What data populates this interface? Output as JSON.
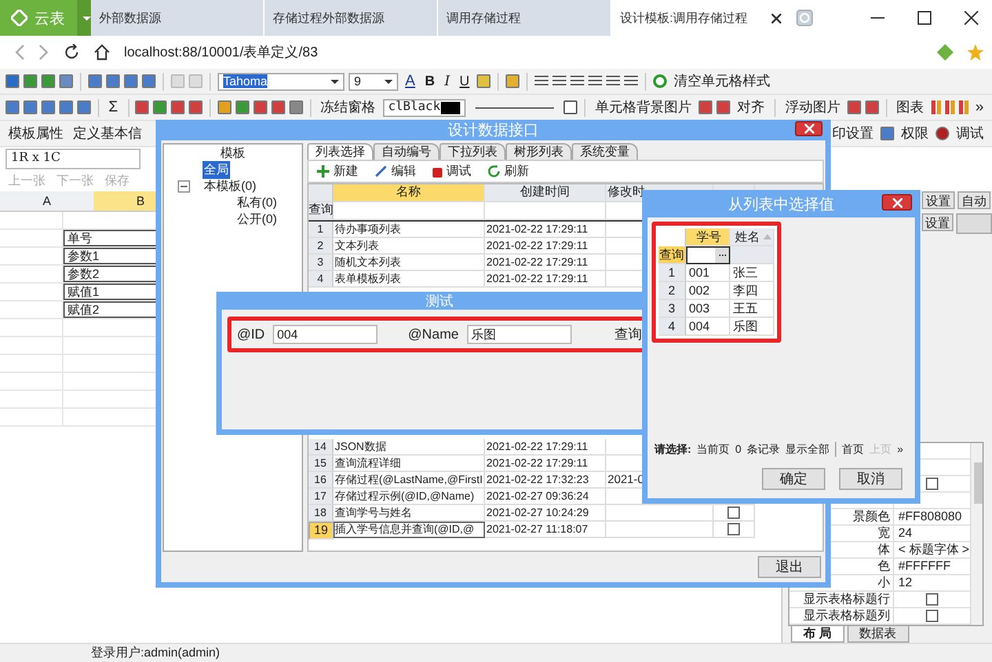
{
  "browser": {
    "brand": "云表",
    "tabs": [
      {
        "label": "外部数据源",
        "selected": false
      },
      {
        "label": "存储过程外部数据源",
        "selected": false
      },
      {
        "label": "调用存储过程",
        "selected": false
      },
      {
        "label": "设计模板:调用存储过程",
        "selected": true
      }
    ],
    "url": "localhost:88/10001/表单定义/83"
  },
  "toolbar": {
    "font": "Tahoma",
    "size": "9",
    "font_color": "A",
    "sum": "Σ",
    "bold": "B",
    "italic": "I",
    "underline": "U",
    "clear_style": "清空单元格样式",
    "freeze": "冻结窗格",
    "color_name": "clBlack",
    "cell_bg": "单元格背景图片",
    "align": "对齐",
    "float_image": "浮动图片",
    "chart": "图表",
    "more": "»",
    "template_props": "模板属性",
    "define_basic": "定义基本信",
    "print_settings": "印设置",
    "permissions": "权限",
    "debug": "调试"
  },
  "cell_ref": "1R x 1C",
  "nav": [
    {
      "label": "上一张",
      "disabled": true
    },
    {
      "label": "下一张",
      "disabled": true
    },
    {
      "label": "保存",
      "disabled": true
    }
  ],
  "sheet": {
    "columns": [
      {
        "label": "A",
        "selected": false
      },
      {
        "label": "B",
        "selected": true
      }
    ],
    "cells": [
      "单号",
      "参数1",
      "参数2",
      "赋值1",
      "赋值2"
    ]
  },
  "right_panel": {
    "buttons": [
      "设置",
      "自动",
      "设置"
    ],
    "properties": [
      {
        "kind": "blank"
      },
      {
        "kind": "blank"
      },
      {
        "kind": "check",
        "checked": false
      },
      {
        "kind": "blank"
      },
      {
        "kind": "text",
        "label": "景颜色",
        "value": "#FF808080"
      },
      {
        "kind": "text",
        "label": "宽",
        "value": "24"
      },
      {
        "kind": "text",
        "label": "体",
        "value": "< 标题字体 >"
      },
      {
        "kind": "text",
        "label": "色",
        "value": "#FFFFFF"
      },
      {
        "kind": "text",
        "label": "小",
        "value": "12"
      },
      {
        "kind": "check",
        "label": "显示表格标题行",
        "checked": false
      },
      {
        "kind": "check",
        "label": "显示表格标题列",
        "checked": false
      }
    ],
    "tabs": [
      {
        "label": "布 局",
        "selected": true
      },
      {
        "label": "数据表",
        "selected": false
      }
    ]
  },
  "status_bar": "登录用户:admin(admin)",
  "design_dialog": {
    "title": "设计数据接口",
    "tree_header": "模板",
    "tree": [
      {
        "label": "全局",
        "selected": true
      },
      {
        "label": "本模板(0)",
        "selected": false,
        "expanded": true,
        "children": [
          {
            "label": "私有(0)",
            "selected": false
          },
          {
            "label": "公开(0)",
            "selected": false
          }
        ]
      }
    ],
    "tabs": [
      {
        "label": "列表选择",
        "selected": true
      },
      {
        "label": "自动编号",
        "selected": false
      },
      {
        "label": "下拉列表",
        "selected": false
      },
      {
        "label": "树形列表",
        "selected": false
      },
      {
        "label": "系统变量",
        "selected": false
      }
    ],
    "actions": [
      {
        "label": "新建",
        "kind": "add"
      },
      {
        "label": "编辑",
        "kind": "edit"
      },
      {
        "label": "调试",
        "kind": "debug"
      },
      {
        "label": "刷新",
        "kind": "refresh"
      }
    ],
    "table": {
      "columns": [
        "名称",
        "创建时间",
        "修改时"
      ],
      "query_label": "查询",
      "rows_top": [
        {
          "num": "1",
          "name": "待办事项列表",
          "created": "2021-02-22 17:29:11",
          "selected": false
        },
        {
          "num": "2",
          "name": "文本列表",
          "created": "2021-02-22 17:29:11",
          "selected": false
        },
        {
          "num": "3",
          "name": "随机文本列表",
          "created": "2021-02-22 17:29:11",
          "selected": false
        },
        {
          "num": "4",
          "name": "表单模板列表",
          "created": "2021-02-22 17:29:11",
          "selected": false
        }
      ],
      "rows_bottom": [
        {
          "num": "14",
          "name": "JSON数据",
          "created": "2021-02-22 17:29:11",
          "selected": false
        },
        {
          "num": "15",
          "name": "查询流程详细",
          "created": "2021-02-22 17:29:11",
          "selected": false
        },
        {
          "num": "16",
          "name": "存储过程(@LastName,@FirstI",
          "created": "2021-02-22 17:32:23",
          "modified": "2021-0",
          "selected": false
        },
        {
          "num": "17",
          "name": "存储过程示例(@ID,@Name)",
          "created": "2021-02-27 09:36:24",
          "selected": false
        },
        {
          "num": "18",
          "name": "查询学号与姓名",
          "created": "2021-02-27 10:24:29",
          "checked": false,
          "selected": false
        },
        {
          "num": "19",
          "name": "插入学号信息并查询(@ID,@",
          "created": "2021-02-27 11:18:07",
          "checked": false,
          "selected": true
        }
      ]
    },
    "exit_button": "退出"
  },
  "test_dialog": {
    "title": "测试",
    "params": [
      {
        "label": "@ID",
        "value": "004"
      },
      {
        "label": "@Name",
        "value": "乐图"
      }
    ],
    "query_button": "查询"
  },
  "select_dialog": {
    "title": "从列表中选择值",
    "columns": [
      {
        "label": "学号",
        "selected": true,
        "sorted": false
      },
      {
        "label": "姓名",
        "selected": false,
        "sorted": true
      }
    ],
    "query_label": "查询",
    "rows": [
      {
        "num": "1",
        "id": "001",
        "name": "张三"
      },
      {
        "num": "2",
        "id": "002",
        "name": "李四"
      },
      {
        "num": "3",
        "id": "003",
        "name": "王五"
      },
      {
        "num": "4",
        "id": "004",
        "name": "乐图"
      }
    ],
    "pager": {
      "prompt": "请选择:",
      "current": "当前页",
      "count": "0",
      "records": "条记录",
      "show_all": "显示全部",
      "first": "首页",
      "prev": "上页",
      "more": "»"
    },
    "buttons": [
      "确定",
      "取消"
    ]
  }
}
